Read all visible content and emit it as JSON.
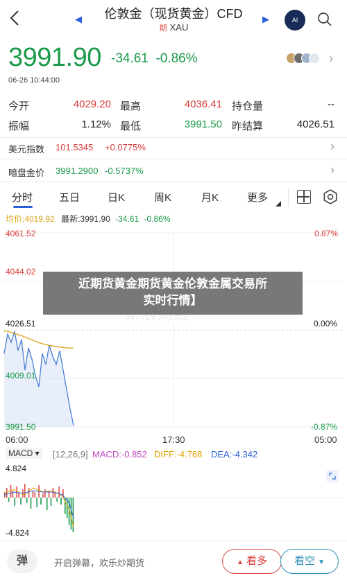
{
  "header": {
    "title": "伦敦金（现货黄金）CFD",
    "tag": "期",
    "symbol": "XAU",
    "ai_label": "AI"
  },
  "quote": {
    "price": "3991.90",
    "change": "-34.61",
    "change_pct": "-0.86%",
    "time": "06-26 10:44:00"
  },
  "stats": {
    "open_label": "今开",
    "open": "4029.20",
    "high_label": "最高",
    "high": "4036.41",
    "oi_label": "持仓量",
    "oi": "--",
    "amp_label": "振幅",
    "amp": "1.12%",
    "low_label": "最低",
    "low": "3991.50",
    "prev_label": "昨结算",
    "prev": "4026.51"
  },
  "usd_index": {
    "label": "美元指数",
    "value": "101.5345",
    "change": "+0.0775%"
  },
  "dark_gold": {
    "label": "暗盘金价",
    "value": "3991.2900",
    "change": "-0.5737%"
  },
  "tabs": [
    {
      "label": "分时"
    },
    {
      "label": "五日"
    },
    {
      "label": "日K"
    },
    {
      "label": "周K"
    },
    {
      "label": "月K"
    },
    {
      "label": "更多"
    }
  ],
  "legend": {
    "avg": "均价:4019.92",
    "latest": "最新:3991.90",
    "chg": "-34.61",
    "pct": "-0.86%"
  },
  "chart_data": {
    "type": "line",
    "title": "",
    "x_ticks": [
      "06:00",
      "17:30",
      "05:00"
    ],
    "y_ticks_left": [
      "4061.52",
      "4044.02",
      "4026.51",
      "4009.01",
      "3991.50"
    ],
    "y_ticks_right": [
      "0.87%",
      "0.00%",
      "-0.87%"
    ],
    "ylim": [
      3991.5,
      4061.52
    ],
    "series": [
      {
        "name": "最新",
        "color": "#4a7fd6",
        "values": [
          4018,
          4025,
          4022,
          4026,
          4019,
          4023,
          4012,
          4020,
          4016,
          4010,
          4006,
          4018,
          4014,
          4021,
          4017,
          4014,
          4019,
          4012,
          4005,
          3998,
          3992
        ]
      },
      {
        "name": "均价",
        "color": "#d9a316",
        "values": [
          4026,
          4026,
          4025.6,
          4025.2,
          4024.8,
          4024.4,
          4023.9,
          4023.4,
          4022.9,
          4022.4,
          4021.9,
          4021.5,
          4021.2,
          4020.9,
          4020.7,
          4020.5,
          4020.3,
          4020.2,
          4020.0,
          4019.95,
          4019.92
        ]
      }
    ],
    "x_label": "",
    "y_label": ""
  },
  "macd": {
    "selector": "MACD",
    "params": "[12,26,9]",
    "macd": "MACD:-0.852",
    "diff": "DIFF:-4.768",
    "dea": "DEA:-4.342",
    "y_top": "4.824",
    "y_bottom": "-4.824"
  },
  "watermark": "新浪财经",
  "banner": {
    "line1": "近期货黄金期货黄金伦敦金属交易所",
    "line2": "实时行情】"
  },
  "bottom": {
    "danmu_icon": "弹",
    "danmu_text": "开启弹幕，欢乐炒期货",
    "bull": "看多",
    "bear": "看空"
  }
}
